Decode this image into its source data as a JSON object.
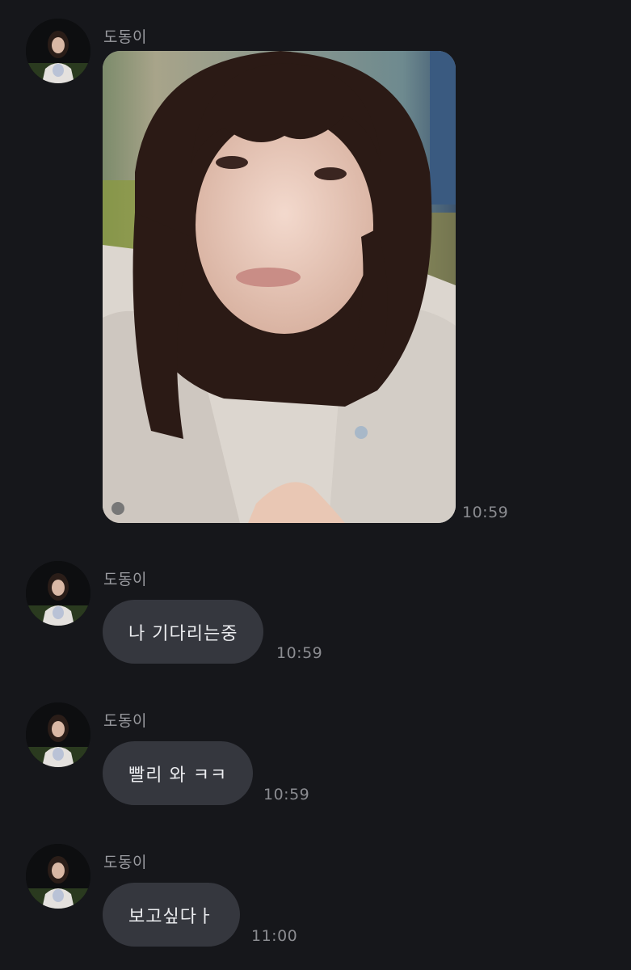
{
  "messages": [
    {
      "sender": "도동이",
      "type": "image",
      "time": "10:59",
      "image_icon": "selfie-photo"
    },
    {
      "sender": "도동이",
      "type": "text",
      "text": "나 기다리는중",
      "time": "10:59"
    },
    {
      "sender": "도동이",
      "type": "text",
      "text": "빨리 와 ㅋㅋ",
      "time": "10:59"
    },
    {
      "sender": "도동이",
      "type": "text",
      "text": "보고싶다ㅏ",
      "time": "11:00"
    }
  ],
  "colors": {
    "background": "#16171b",
    "bubble": "#35373e",
    "bubble_text": "#ecedf0",
    "sender_text": "#9a9ba0",
    "time_text": "#8b8c91"
  }
}
